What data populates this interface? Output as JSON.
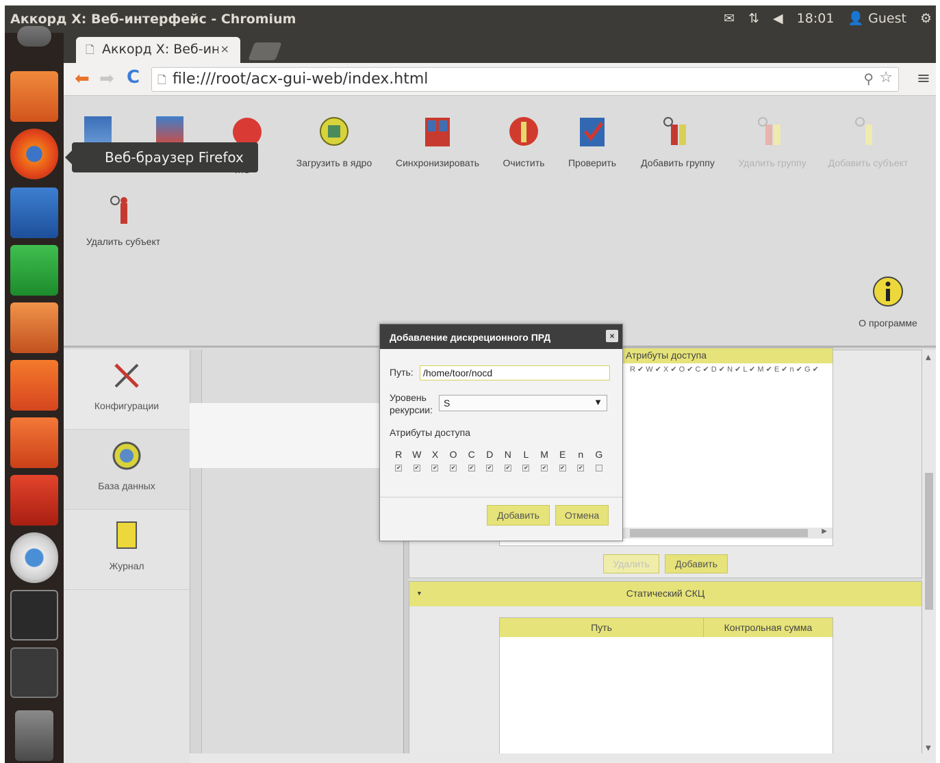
{
  "window": {
    "title": "Аккорд X: Веб-интерфейс - Chromium",
    "clock": "18:01",
    "user": "Guest"
  },
  "browser": {
    "tab_title": "Аккорд X: Веб-интерф",
    "tab_close": "×",
    "url": "file:///root/acx-gui-web/index.html"
  },
  "tooltip": "Веб-браузер Firefox",
  "ribbon": {
    "partial_label": "ить",
    "buttons": [
      {
        "label": "Загрузить в ядро",
        "icon": "load-kernel-icon"
      },
      {
        "label": "Синхронизировать",
        "icon": "sync-icon"
      },
      {
        "label": "Очистить",
        "icon": "clear-icon"
      },
      {
        "label": "Проверить",
        "icon": "verify-icon"
      },
      {
        "label": "Добавить группу",
        "icon": "add-group-icon"
      },
      {
        "label": "Удалить группу",
        "icon": "delete-group-icon"
      },
      {
        "label": "Добавить субъект",
        "icon": "add-subject-icon"
      }
    ],
    "delete_subject": "Удалить субъект",
    "about": "О программе"
  },
  "nav": {
    "items": [
      {
        "label": "Конфигурации",
        "icon": "tools-icon"
      },
      {
        "label": "База данных",
        "icon": "database-icon"
      },
      {
        "label": "Журнал",
        "icon": "journal-icon"
      }
    ]
  },
  "acl_panel": {
    "header": "Атрибуты доступа",
    "attr_row": "R ✔ W ✔ X ✔ O ✔ C ✔ D ✔ N ✔ L ✔ M ✔ E ✔ n ✔ G ✔",
    "delete_button": "Удалить",
    "add_button": "Добавить"
  },
  "skc": {
    "title": "Статический СКЦ",
    "col_path": "Путь",
    "col_checksum": "Контрольная сумма"
  },
  "dialog": {
    "title": "Добавление дискреционного ПРД",
    "close": "×",
    "path_label": "Путь:",
    "path_value": "/home/toor/nocd",
    "recursion_label_1": "Уровень",
    "recursion_label_2": "рекурсии:",
    "recursion_value": "S",
    "attrs_label": "Атрибуты доступа",
    "flags": [
      "R",
      "W",
      "X",
      "O",
      "C",
      "D",
      "N",
      "L",
      "M",
      "E",
      "n",
      "G"
    ],
    "flags_checked": [
      true,
      true,
      true,
      true,
      true,
      true,
      true,
      true,
      true,
      true,
      true,
      false
    ],
    "add_button": "Добавить",
    "cancel_button": "Отмена"
  },
  "colors": {
    "accent_yellow": "#e6e37a",
    "dialog_header": "#3e3e3e",
    "ubuntu_bar": "#3c3b37"
  }
}
